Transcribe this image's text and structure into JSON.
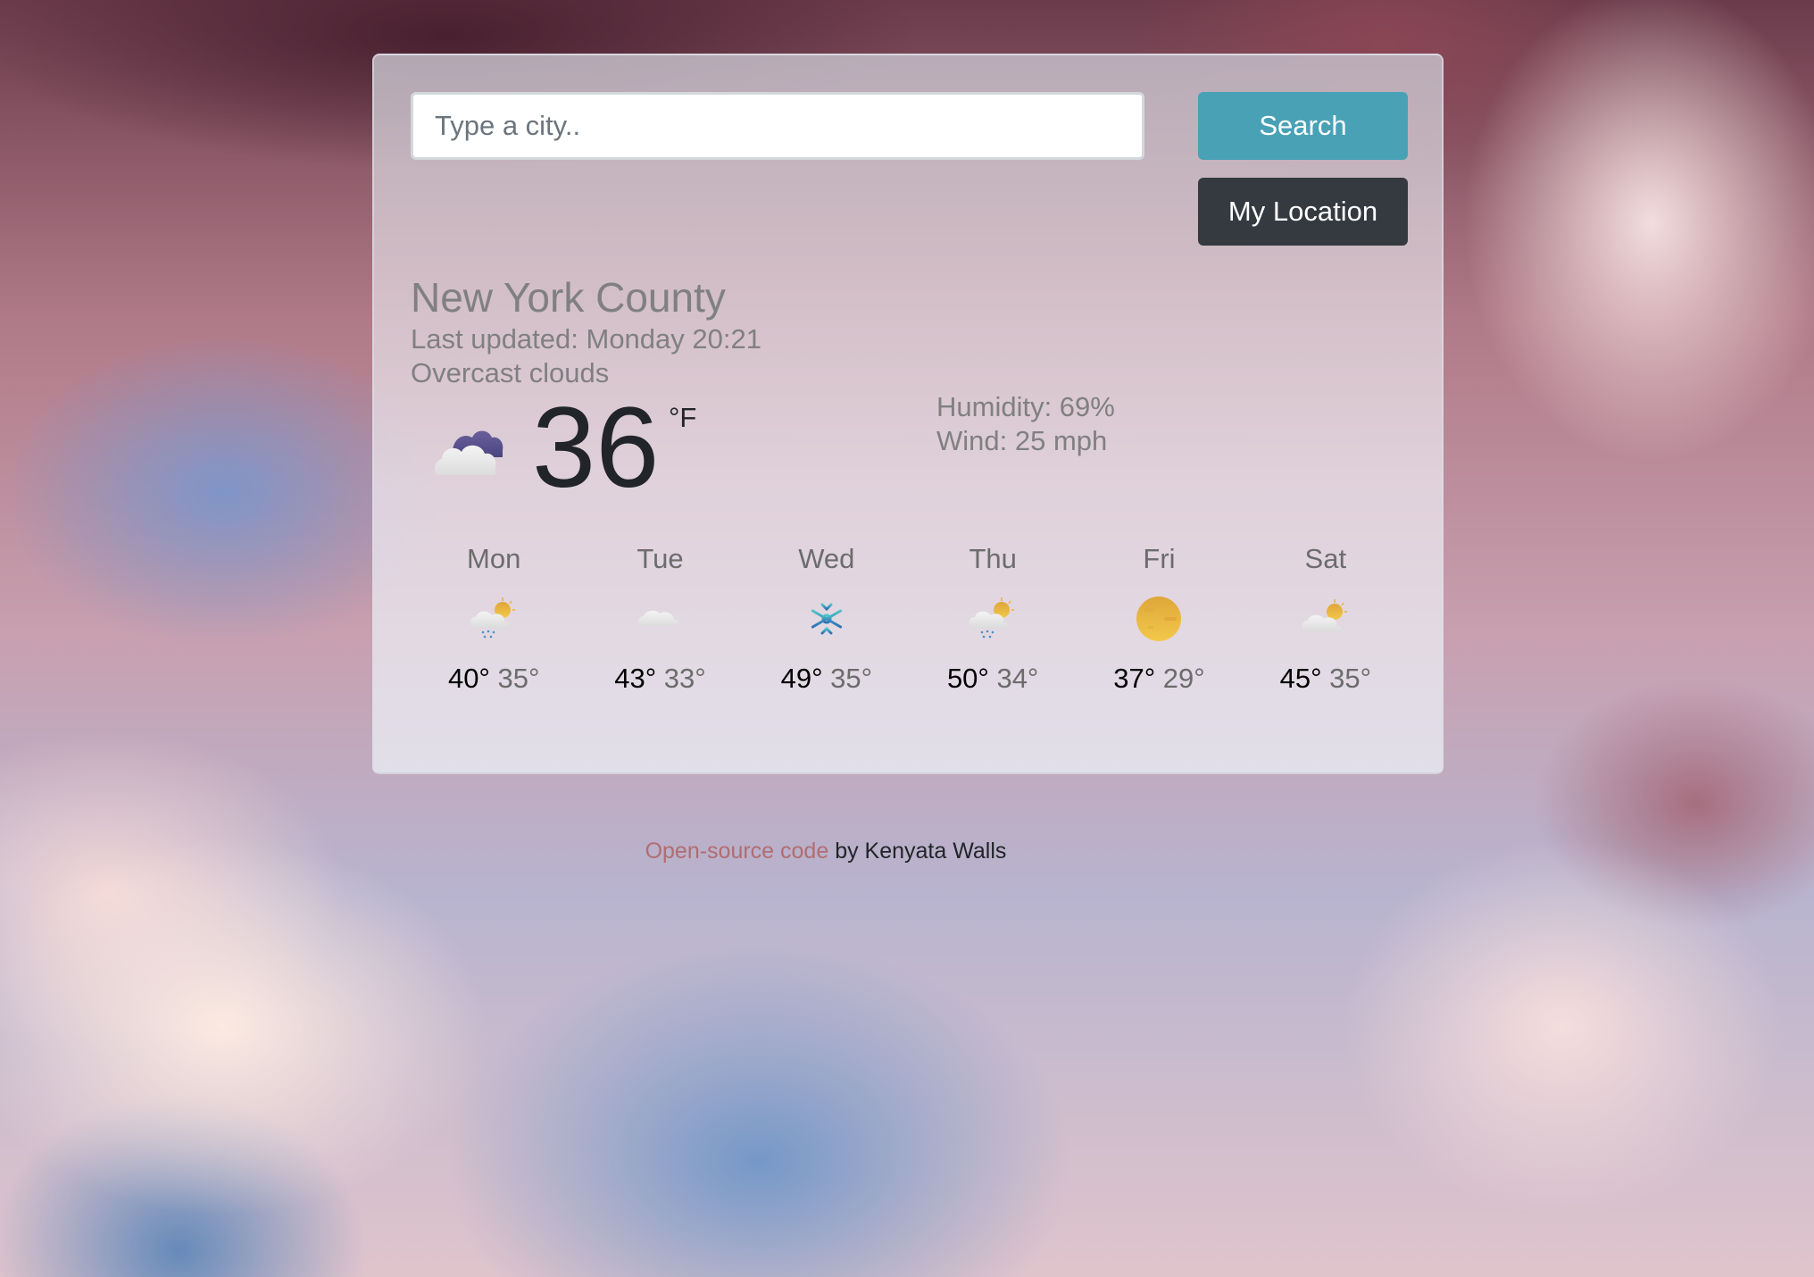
{
  "search": {
    "placeholder": "Type a city..",
    "value": "",
    "search_button": "Search",
    "location_button": "My Location"
  },
  "current": {
    "city": "New York County",
    "last_updated": "Last updated: Monday 20:21",
    "description": "Overcast clouds",
    "icon": "overcast-clouds-icon",
    "temperature": "36",
    "unit": "°F",
    "humidity": "Humidity: 69%",
    "wind": "Wind: 25 mph"
  },
  "forecast": [
    {
      "day": "Mon",
      "icon": "sun-cloud-rain-icon",
      "high": "40°",
      "low": "35°"
    },
    {
      "day": "Tue",
      "icon": "cloud-icon",
      "high": "43°",
      "low": "33°"
    },
    {
      "day": "Wed",
      "icon": "snowflake-icon",
      "high": "49°",
      "low": "35°"
    },
    {
      "day": "Thu",
      "icon": "sun-cloud-rain-icon",
      "high": "50°",
      "low": "34°"
    },
    {
      "day": "Fri",
      "icon": "sun-icon",
      "high": "37°",
      "low": "29°"
    },
    {
      "day": "Sat",
      "icon": "sun-cloud-icon",
      "high": "45°",
      "low": "35°"
    }
  ],
  "footer": {
    "link_text": "Open-source code",
    "suffix": " by Kenyata Walls"
  },
  "colors": {
    "search_button": "#49a1b6",
    "location_button": "#343a40",
    "link": "#b06d72",
    "muted_text": "#808080"
  }
}
